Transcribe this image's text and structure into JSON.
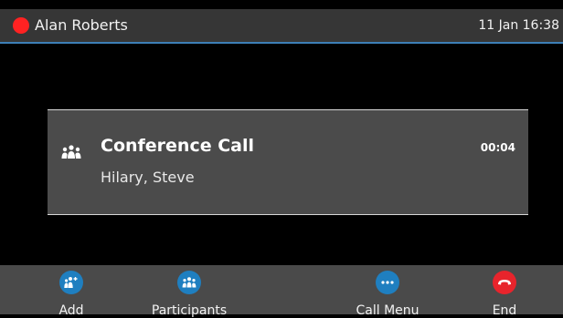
{
  "header": {
    "caller_name": "Alan Roberts",
    "datetime": "11 Jan 16:38",
    "status_color": "#ff2222",
    "accent_color": "#3d7fb6"
  },
  "call": {
    "title": "Conference Call",
    "participants": "Hilary, Steve",
    "duration": "00:04",
    "icon": "conference-icon"
  },
  "softkeys": [
    {
      "label": "Add",
      "icon": "add-participant-icon",
      "color": "#1f7fc0"
    },
    {
      "label": "Participants",
      "icon": "participants-icon",
      "color": "#1f7fc0"
    },
    {
      "label": "Call Menu",
      "icon": "more-icon",
      "color": "#1f7fc0"
    },
    {
      "label": "End",
      "icon": "hang-up-icon",
      "color": "#e8242c"
    }
  ]
}
